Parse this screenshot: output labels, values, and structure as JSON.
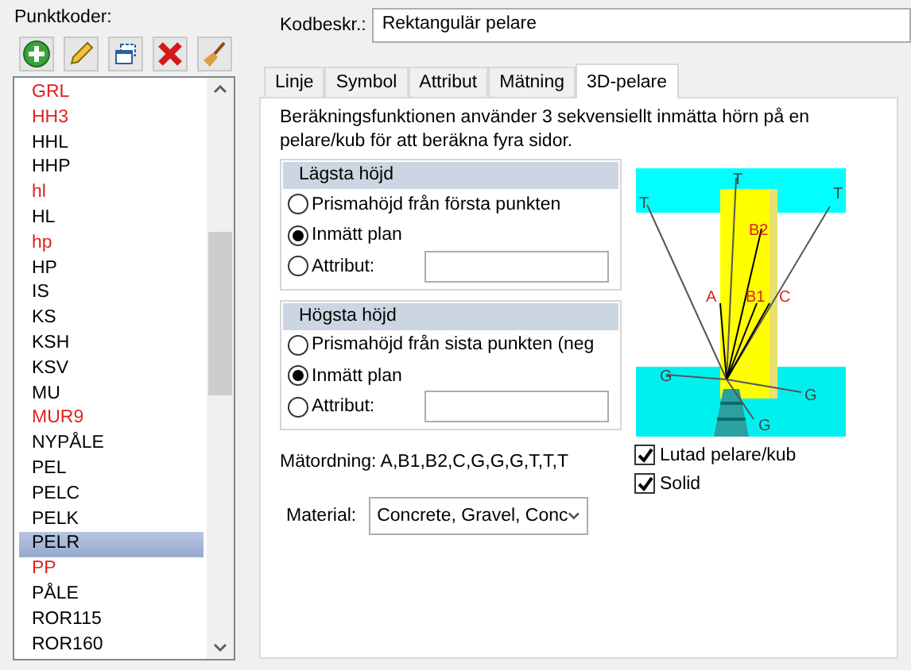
{
  "left_panel": {
    "label": "Punktkoder:",
    "toolbar": [
      {
        "kind": "add"
      },
      {
        "kind": "edit"
      },
      {
        "kind": "copy"
      },
      {
        "kind": "delete"
      },
      {
        "kind": "clean"
      }
    ],
    "codes": [
      {
        "label": "GRL",
        "color": "#e0201f",
        "selected": false
      },
      {
        "label": "HH3",
        "color": "#e0201f",
        "selected": false
      },
      {
        "label": "HHL",
        "color": "#000000",
        "selected": false
      },
      {
        "label": "HHP",
        "color": "#000000",
        "selected": false
      },
      {
        "label": "hl",
        "color": "#e0201f",
        "selected": false
      },
      {
        "label": "HL",
        "color": "#000000",
        "selected": false
      },
      {
        "label": "hp",
        "color": "#e0201f",
        "selected": false
      },
      {
        "label": "HP",
        "color": "#000000",
        "selected": false
      },
      {
        "label": "IS",
        "color": "#000000",
        "selected": false
      },
      {
        "label": "KS",
        "color": "#000000",
        "selected": false
      },
      {
        "label": "KSH",
        "color": "#000000",
        "selected": false
      },
      {
        "label": "KSV",
        "color": "#000000",
        "selected": false
      },
      {
        "label": "MU",
        "color": "#000000",
        "selected": false
      },
      {
        "label": "MUR9",
        "color": "#e0201f",
        "selected": false
      },
      {
        "label": "NYPÅLE",
        "color": "#000000",
        "selected": false
      },
      {
        "label": "PEL",
        "color": "#000000",
        "selected": false
      },
      {
        "label": "PELC",
        "color": "#000000",
        "selected": false
      },
      {
        "label": "PELK",
        "color": "#000000",
        "selected": false
      },
      {
        "label": "PELR",
        "color": "#000000",
        "selected": true
      },
      {
        "label": "PP",
        "color": "#e0201f",
        "selected": false
      },
      {
        "label": "PÅLE",
        "color": "#000000",
        "selected": false
      },
      {
        "label": "ROR115",
        "color": "#000000",
        "selected": false
      },
      {
        "label": "ROR160",
        "color": "#000000",
        "selected": false
      }
    ]
  },
  "code_description": {
    "label": "Kodbeskr.:",
    "value": "Rektangulär pelare"
  },
  "tabs": [
    {
      "label": "Linje",
      "selected": false
    },
    {
      "label": "Symbol",
      "selected": false
    },
    {
      "label": "Attribut",
      "selected": false
    },
    {
      "label": "Mätning",
      "selected": false
    },
    {
      "label": "3D-pelare",
      "selected": true
    }
  ],
  "intro": "Beräkningsfunktionen använder 3 sekvensiellt inmätta hörn på en pelare/kub för att beräkna fyra sidor.",
  "groups": [
    {
      "title": "Lägsta höjd",
      "options": [
        {
          "label": "Prismahöjd från första punkten",
          "selected": false,
          "kind": "plain"
        },
        {
          "label": "Inmätt plan",
          "selected": true,
          "kind": "plain"
        },
        {
          "label": "Attribut:",
          "selected": false,
          "kind": "field"
        }
      ]
    },
    {
      "title": "Högsta höjd",
      "options": [
        {
          "label": "Prismahöjd från sista punkten (neg",
          "selected": false,
          "kind": "plain"
        },
        {
          "label": "Inmätt plan",
          "selected": true,
          "kind": "plain"
        },
        {
          "label": "Attribut:",
          "selected": false,
          "kind": "field"
        }
      ]
    }
  ],
  "measure_order": "Mätordning: A,B1,B2,C,G,G,G,T,T,T",
  "material": {
    "label": "Material:",
    "value": "Concrete, Gravel, Conc"
  },
  "diagram_labels": [
    "T",
    "T",
    "T",
    "B2",
    "A",
    "B1",
    "C",
    "G",
    "G",
    "G"
  ],
  "options": [
    {
      "label": "Lutad pelare/kub",
      "checked": true
    },
    {
      "label": "Solid",
      "checked": true
    }
  ]
}
